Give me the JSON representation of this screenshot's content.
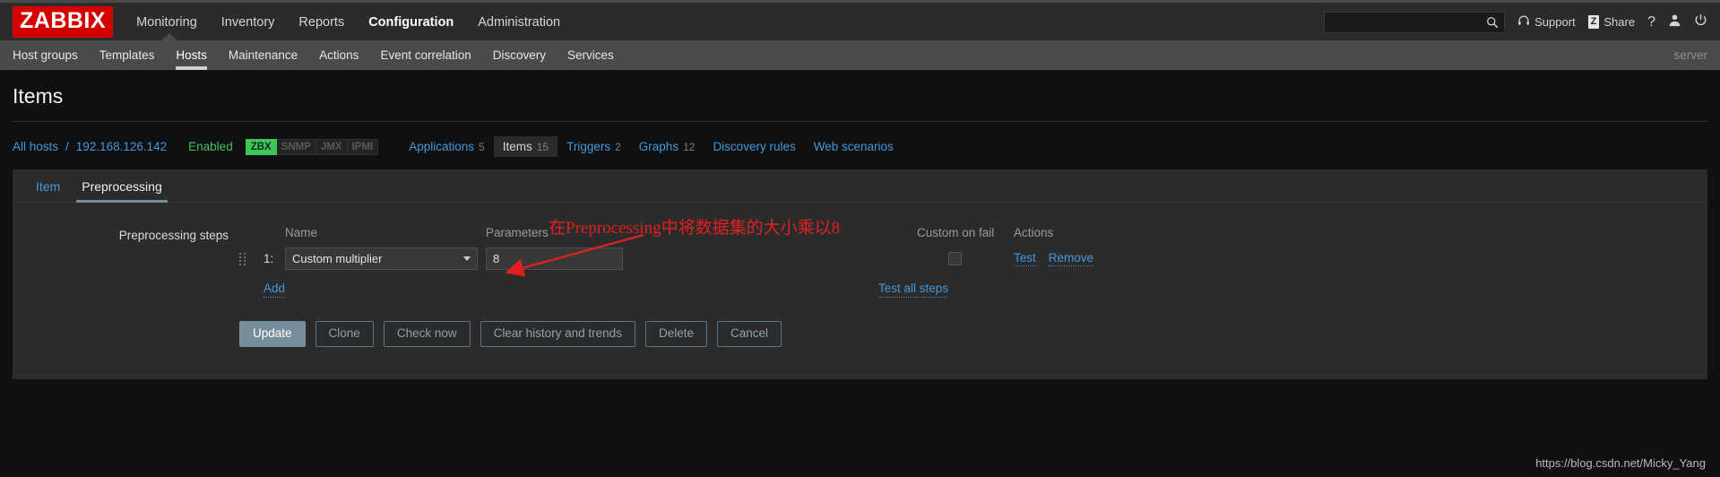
{
  "header": {
    "logo": "ZABBIX",
    "nav": [
      {
        "label": "Monitoring",
        "active": false
      },
      {
        "label": "Inventory",
        "active": false
      },
      {
        "label": "Reports",
        "active": false
      },
      {
        "label": "Configuration",
        "active": true
      },
      {
        "label": "Administration",
        "active": false
      }
    ],
    "search": {
      "value": "",
      "placeholder": ""
    },
    "support_label": "Support",
    "share_label": "Share",
    "share_badge": "Z",
    "help_label": "?",
    "icons": {
      "search": "search-icon",
      "support": "headset-icon",
      "share": "share-icon",
      "help": "question-mark-icon",
      "user": "user-icon",
      "signout": "power-icon"
    }
  },
  "subnav": {
    "items": [
      {
        "label": "Host groups",
        "active": false
      },
      {
        "label": "Templates",
        "active": false
      },
      {
        "label": "Hosts",
        "active": true
      },
      {
        "label": "Maintenance",
        "active": false
      },
      {
        "label": "Actions",
        "active": false
      },
      {
        "label": "Event correlation",
        "active": false
      },
      {
        "label": "Discovery",
        "active": false
      },
      {
        "label": "Services",
        "active": false
      }
    ],
    "server_label": "server"
  },
  "page": {
    "title": "Items"
  },
  "breadcrumb": {
    "all_hosts": "All hosts",
    "separator": "/",
    "host": "192.168.126.142",
    "status": "Enabled",
    "interfaces": [
      {
        "label": "ZBX",
        "enabled": true
      },
      {
        "label": "SNMP",
        "enabled": false
      },
      {
        "label": "JMX",
        "enabled": false
      },
      {
        "label": "IPMI",
        "enabled": false
      }
    ],
    "tabs": [
      {
        "label": "Applications",
        "count": "5",
        "active": false
      },
      {
        "label": "Items",
        "count": "15",
        "active": true
      },
      {
        "label": "Triggers",
        "count": "2",
        "active": false
      },
      {
        "label": "Graphs",
        "count": "12",
        "active": false
      },
      {
        "label": "Discovery rules",
        "count": "",
        "active": false
      },
      {
        "label": "Web scenarios",
        "count": "",
        "active": false
      }
    ]
  },
  "form": {
    "tabs": [
      {
        "label": "Item",
        "active": false
      },
      {
        "label": "Preprocessing",
        "active": true
      }
    ],
    "section_label": "Preprocessing steps",
    "columns": {
      "name": "Name",
      "parameters": "Parameters",
      "custom_on_fail": "Custom on fail",
      "actions": "Actions"
    },
    "steps": [
      {
        "number": "1:",
        "name": "Custom multiplier",
        "parameters": "8",
        "custom_on_fail_checked": false,
        "test_label": "Test",
        "remove_label": "Remove"
      }
    ],
    "add_label": "Add",
    "test_all_label": "Test all steps",
    "buttons": [
      {
        "label": "Update",
        "primary": true
      },
      {
        "label": "Clone",
        "primary": false
      },
      {
        "label": "Check now",
        "primary": false
      },
      {
        "label": "Clear history and trends",
        "primary": false
      },
      {
        "label": "Delete",
        "primary": false
      },
      {
        "label": "Cancel",
        "primary": false
      }
    ]
  },
  "annotation": {
    "text": "在Preprocessing中将数据集的大小乘以8",
    "color": "#e02020"
  },
  "watermark": "https://blog.csdn.net/Micky_Yang"
}
